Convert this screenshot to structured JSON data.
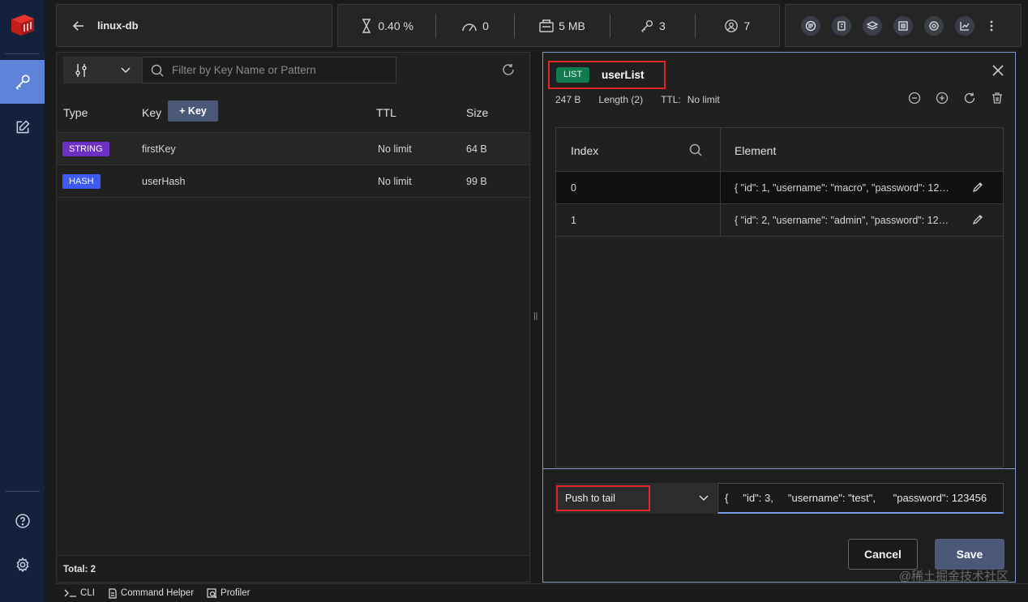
{
  "connection": {
    "name": "linux-db"
  },
  "stats": {
    "cpu": "0.40 %",
    "ops": "0",
    "memory": "5 MB",
    "keys": "3",
    "clients": "7"
  },
  "filter": {
    "placeholder": "Filter by Key Name or Pattern"
  },
  "keys_table": {
    "headers": {
      "type": "Type",
      "key": "Key",
      "ttl": "TTL",
      "size": "Size"
    },
    "add_key_label": "+ Key",
    "rows": [
      {
        "type": "STRING",
        "key": "firstKey",
        "ttl": "No limit",
        "size": "64 B"
      },
      {
        "type": "HASH",
        "key": "userHash",
        "ttl": "No limit",
        "size": "99 B"
      }
    ],
    "total": "Total: 2"
  },
  "details": {
    "type_badge": "LIST",
    "key_name": "userList",
    "size": "247 B",
    "length": "Length (2)",
    "ttl_label": "TTL:",
    "ttl_value": "No limit",
    "headers": {
      "index": "Index",
      "element": "Element"
    },
    "elements": [
      {
        "index": "0",
        "value": "{ \"id\": 1, \"username\": \"macro\", \"password\": 1234..."
      },
      {
        "index": "1",
        "value": "{ \"id\": 2, \"username\": \"admin\", \"password\": 1234..."
      }
    ],
    "push_option": "Push to tail",
    "push_value": "{     \"id\": 3,     \"username\": \"test\",      \"password\": 123456",
    "cancel_label": "Cancel",
    "save_label": "Save"
  },
  "bottom_bar": {
    "cli": "CLI",
    "command_helper": "Command Helper",
    "profiler": "Profiler"
  },
  "watermark": "@稀土掘金技术社区",
  "colors": {
    "accent": "#5e84d9",
    "string_badge": "#6d2fc6",
    "hash_badge": "#3d5bf2",
    "list_badge": "#0f7b4e",
    "highlight": "#e0262b"
  }
}
